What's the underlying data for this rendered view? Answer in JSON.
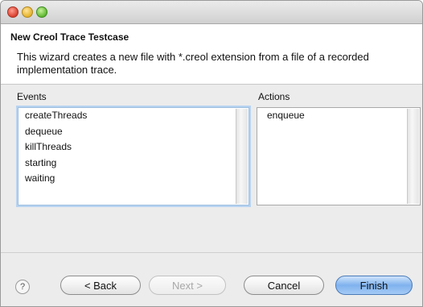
{
  "window": {
    "title_bar_buttons": [
      "close",
      "minimize",
      "zoom"
    ]
  },
  "header": {
    "title": "New Creol Trace Testcase",
    "description": "This wizard creates a new file with *.creol extension from a file of a recorded implementation trace."
  },
  "events": {
    "label": "Events",
    "items": [
      "createThreads",
      "dequeue",
      "killThreads",
      "starting",
      "waiting"
    ]
  },
  "actions": {
    "label": "Actions",
    "items": [
      "enqueue"
    ]
  },
  "footer": {
    "help_icon": "?",
    "back_label": "< Back",
    "next_label": "Next >",
    "cancel_label": "Cancel",
    "finish_label": "Finish"
  }
}
